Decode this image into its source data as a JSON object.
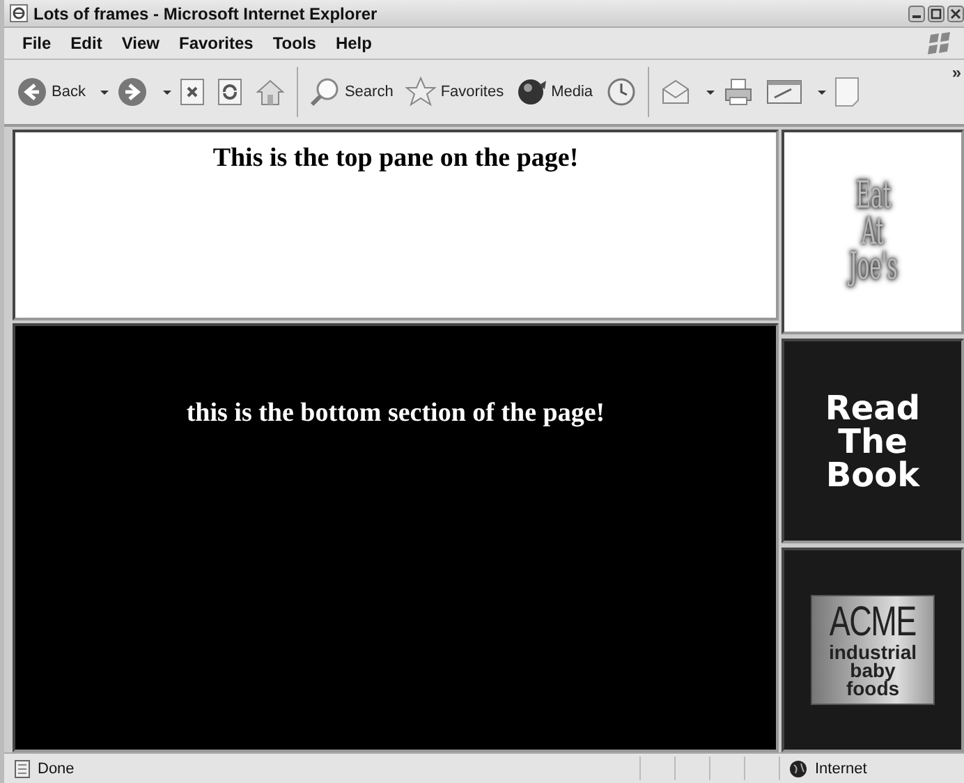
{
  "window": {
    "title": "Lots of frames - Microsoft Internet Explorer"
  },
  "menu": [
    "File",
    "Edit",
    "View",
    "Favorites",
    "Tools",
    "Help"
  ],
  "toolbar": {
    "buttons": [
      {
        "kind": "back",
        "label": "Back",
        "dropdown": true
      },
      {
        "kind": "forward",
        "dropdown": true
      },
      {
        "kind": "stop",
        "dropdown": false
      },
      {
        "kind": "refresh",
        "dropdown": false
      },
      {
        "kind": "home",
        "dropdown": false
      },
      {
        "kind": "search",
        "label": "Search",
        "dropdown": false
      },
      {
        "kind": "favorites",
        "label": "Favorites",
        "dropdown": false
      },
      {
        "kind": "media",
        "label": "Media",
        "dropdown": false
      },
      {
        "kind": "history",
        "dropdown": false
      },
      {
        "kind": "mail",
        "dropdown": true
      },
      {
        "kind": "print",
        "dropdown": false
      },
      {
        "kind": "edit",
        "dropdown": true
      },
      {
        "kind": "discuss",
        "dropdown": false
      }
    ],
    "overflow": "»"
  },
  "top_pane": {
    "heading": "This is the top pane on the page!"
  },
  "bottom_pane": {
    "heading": "this is the bottom section of the page!"
  },
  "side_frames": [
    {
      "kind": "joes",
      "lines": [
        "Eat",
        "At",
        "Joe's"
      ]
    },
    {
      "kind": "book",
      "lines": [
        "Read",
        "The",
        "Book"
      ]
    },
    {
      "kind": "acme",
      "lines": [
        "ACME",
        "industrial",
        "baby",
        "foods"
      ]
    }
  ],
  "status_bar": {
    "text": "Done",
    "zone": "Internet"
  }
}
